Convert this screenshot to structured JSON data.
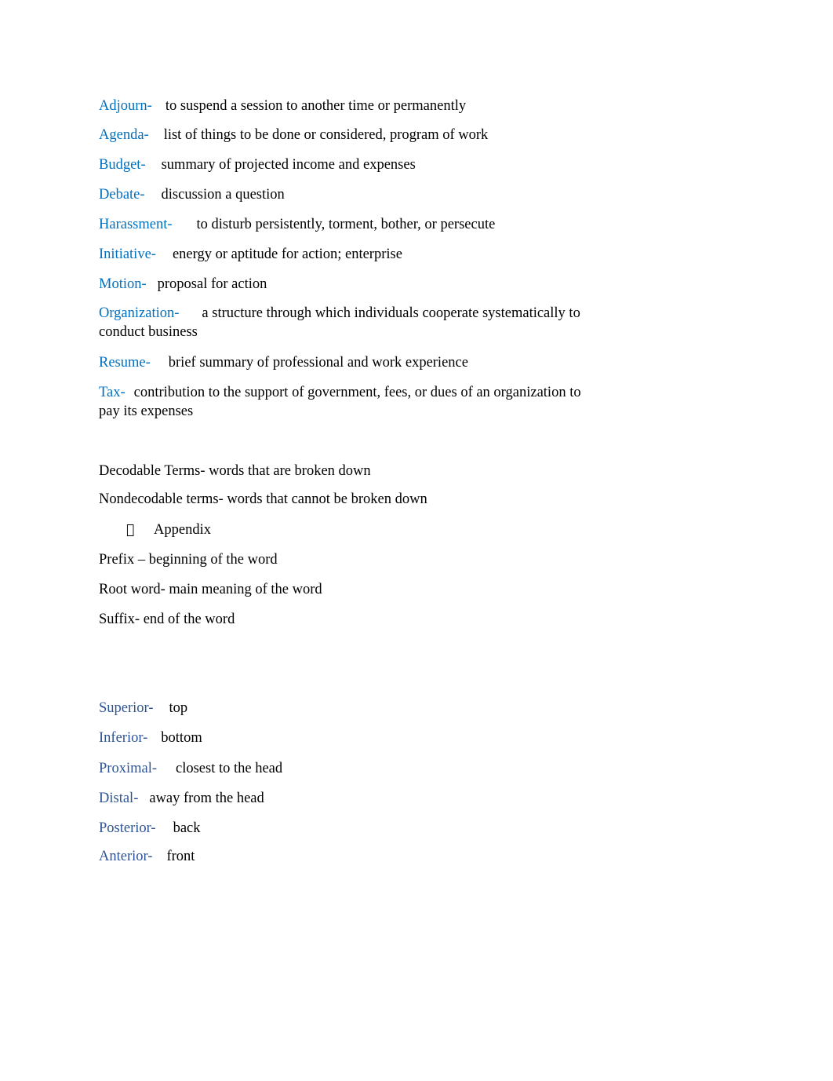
{
  "colors": {
    "term_blue": "#0070c0",
    "term_blue_dark": "#2f5496",
    "text": "#000000"
  },
  "business_terms": [
    {
      "term": "Adjourn-",
      "gap": "    ",
      "definition": "to suspend a session to another time or permanently"
    },
    {
      "term": "Agenda-",
      "gap": "    ",
      "definition": "list of things to be done or considered, program of work"
    },
    {
      "term": "Budget-",
      "gap": "    ",
      "definition": "summary of projected income and expenses"
    },
    {
      "term": "Debate-",
      "gap": "    ",
      "definition": "discussion a question"
    },
    {
      "term": "Harassment-",
      "gap": "       ",
      "definition": "to disturb persistently, torment, bother, or persecute"
    },
    {
      "term": "Initiative-",
      "gap": "    ",
      "definition": "energy or aptitude for action; enterprise"
    },
    {
      "term": "Motion-",
      "gap": "  ",
      "definition": "proposal for action"
    },
    {
      "term": "Organization-",
      "gap": "       ",
      "definition": "a structure through which individuals cooperate systematically to conduct business"
    },
    {
      "term": "Resume-",
      "gap": "    ",
      "definition": "brief summary of professional and work experience"
    },
    {
      "term": "Tax-",
      "gap": "  ",
      "definition": "contribution to the support of government, fees, or dues of an organization to pay its expenses"
    }
  ],
  "word_parts": {
    "decodable": "Decodable Terms- words that are broken down",
    "nondecodable": "Nondecodable terms- words that cannot be broken down",
    "bullet_glyph": "",
    "bullet_item": "Appendix",
    "prefix": "Prefix – beginning of the word",
    "root": "Root word- main meaning of the word",
    "suffix": "Suffix- end of the word"
  },
  "directional_terms": [
    {
      "term": "Superior-",
      "definition": "top"
    },
    {
      "term": "Inferior-",
      "definition": "bottom"
    },
    {
      "term": "Proximal-",
      "definition": "closest to the head"
    },
    {
      "term": "Distal-",
      "definition": "away from the head"
    },
    {
      "term": "Posterior-",
      "definition": "back"
    },
    {
      "term": "Anterior-",
      "definition": "front"
    }
  ]
}
